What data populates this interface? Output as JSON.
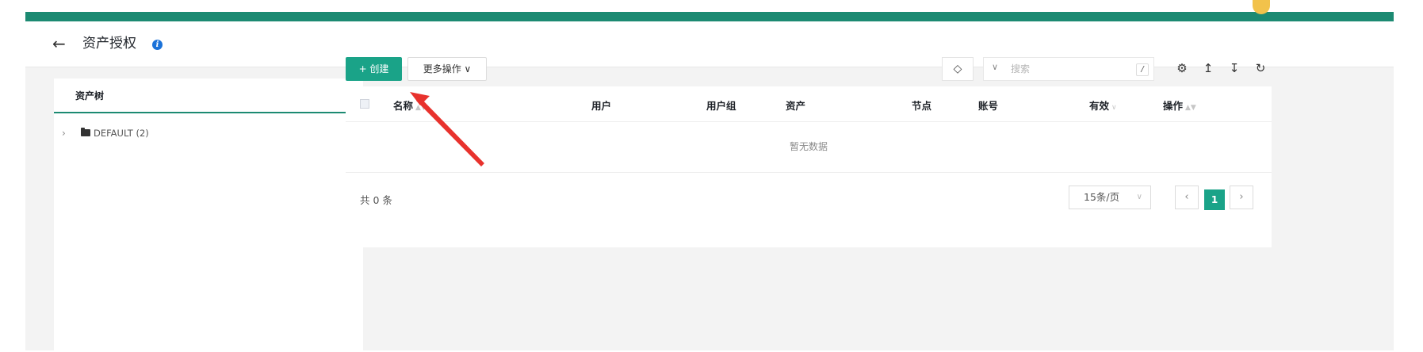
{
  "header": {
    "title": "资产授权",
    "back_icon": "arrow-left-icon",
    "info_icon": "info-icon",
    "brand_color": "#1c8a72"
  },
  "sidebar": {
    "tab_label": "资产树",
    "nodes": [
      {
        "label": "DEFAULT (2)",
        "icon": "folder-icon",
        "expanded": false
      }
    ]
  },
  "toolbar": {
    "create_label": "+ 创建",
    "more_label": "更多操作 ∨",
    "search": {
      "placeholder": "搜索",
      "shortcut": "/"
    },
    "icons": [
      "tag-icon",
      "settings-icon",
      "export-icon",
      "import-icon",
      "refresh-icon"
    ]
  },
  "table": {
    "columns": [
      "名称",
      "用户",
      "用户组",
      "资产",
      "节点",
      "账号",
      "有效",
      "操作"
    ],
    "empty_text": "暂无数据",
    "total_label": "共 0 条",
    "page_size": "15条/页",
    "current_page": "1",
    "accent_color": "#1aa388"
  },
  "annotation": {
    "type": "red-arrow",
    "color": "#e8322d"
  }
}
